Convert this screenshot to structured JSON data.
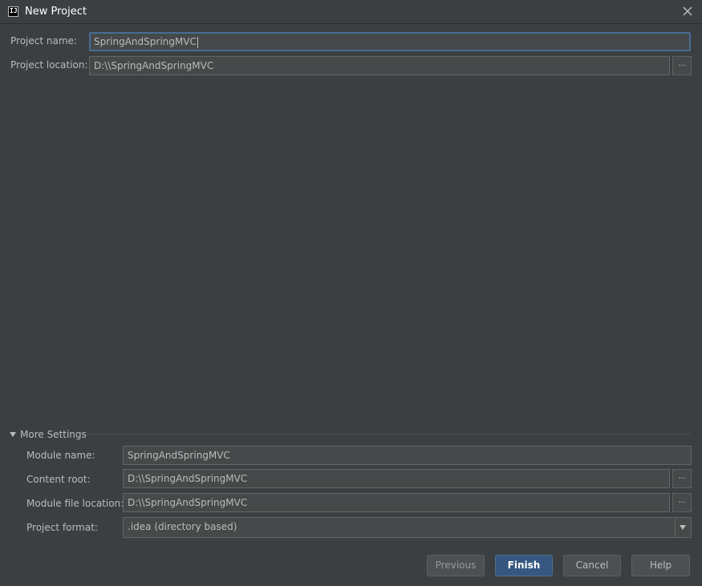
{
  "window": {
    "title": "New Project",
    "app_icon_text": "IJ"
  },
  "project": {
    "name_label": "Project name:",
    "name_value": "SpringAndSpringMVC",
    "location_label": "Project location:",
    "location_value": "D:\\\\SpringAndSpringMVC",
    "browse_label": "..."
  },
  "more_settings": {
    "toggle_label": "More Settings",
    "module_name_label": "Module name:",
    "module_name_value": "SpringAndSpringMVC",
    "content_root_label": "Content root:",
    "content_root_value": "D:\\\\SpringAndSpringMVC",
    "module_file_location_label": "Module file location:",
    "module_file_location_value": "D:\\\\SpringAndSpringMVC",
    "project_format_label": "Project format:",
    "project_format_value": ".idea (directory based)",
    "browse_label": "..."
  },
  "buttons": {
    "previous": "Previous",
    "finish": "Finish",
    "cancel": "Cancel",
    "help": "Help"
  },
  "colors": {
    "background": "#3c3f41",
    "field_background": "#45494a",
    "focus_border": "#466d94",
    "default_button": "#365880",
    "text": "#bbbbbb"
  }
}
